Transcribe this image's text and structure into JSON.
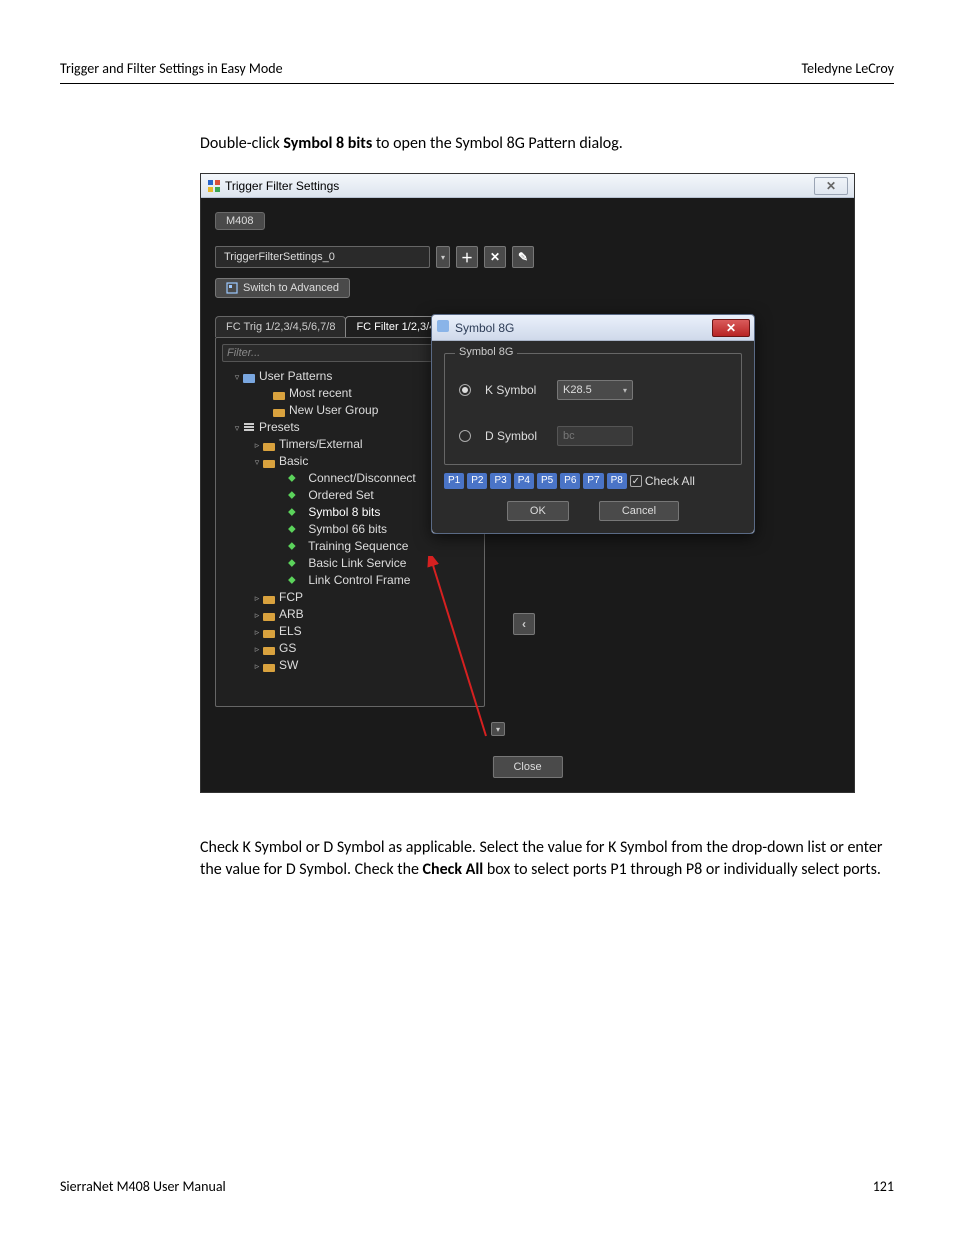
{
  "page": {
    "header_left": "Trigger and Filter Settings in Easy Mode",
    "header_right": "Teledyne  LeCroy",
    "intro_pre": "Double-click ",
    "intro_bold": "Symbol 8 bits",
    "intro_post": " to open the Symbol 8G Pattern dialog.",
    "body_pre": "Check K Symbol or D Symbol as applicable. Select the value for K Symbol from the drop-down list or enter the value for D Symbol. Check the ",
    "body_bold": "Check All",
    "body_post": " box to select ports P1 through P8 or individually select ports.",
    "footer_left": "SierraNet M408 User Manual",
    "footer_right": "121"
  },
  "window": {
    "title": "Trigger Filter Settings",
    "tab_chip": "M408",
    "settings_name": "TriggerFilterSettings_0",
    "switch_btn": "Switch to Advanced",
    "tabs": {
      "trig": "FC Trig 1/2,3/4,5/6,7/8",
      "filter": "FC Filter 1/2,3/4,"
    },
    "filter_placeholder": "Filter...",
    "close_btn": "Close"
  },
  "tree": {
    "user_patterns": "User Patterns",
    "most_recent": "Most recent",
    "new_user_group": "New User Group",
    "presets": "Presets",
    "timers": "Timers/External",
    "basic": "Basic",
    "connect": "Connect/Disconnect",
    "ordered": "Ordered Set",
    "sym8": "Symbol 8 bits",
    "sym66": "Symbol 66 bits",
    "training": "Training Sequence",
    "bls": "Basic Link Service",
    "lcf": "Link Control Frame",
    "fcp": "FCP",
    "arb": "ARB",
    "els": "ELS",
    "gs": "GS",
    "sw": "SW"
  },
  "popup": {
    "title": "Symbol 8G",
    "legend": "Symbol 8G",
    "ksymbol": "K Symbol",
    "dsymbol": "D Symbol",
    "kvalue": "K28.5",
    "dvalue": "bc",
    "ports": [
      "P1",
      "P2",
      "P3",
      "P4",
      "P5",
      "P6",
      "P7",
      "P8"
    ],
    "check_all": "Check All",
    "ok": "OK",
    "cancel": "Cancel"
  }
}
